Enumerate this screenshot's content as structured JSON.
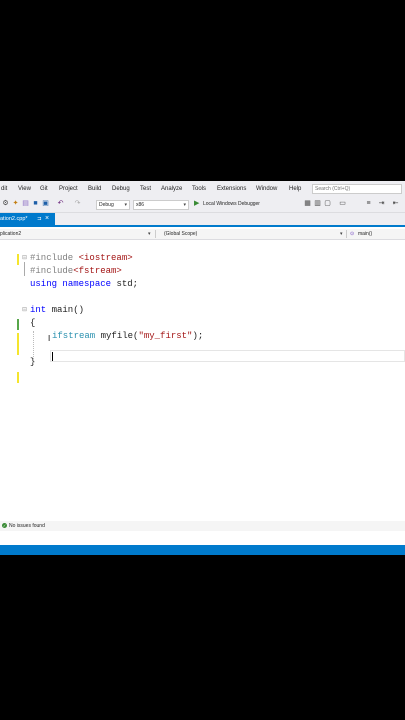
{
  "menu": {
    "items": [
      "dit",
      "View",
      "Git",
      "Project",
      "Build",
      "Debug",
      "Test",
      "Analyze",
      "Tools",
      "Extensions",
      "Window",
      "Help"
    ],
    "search_placeholder": "Search (Ctrl+Q)"
  },
  "toolbar": {
    "config": "Debug",
    "platform": "x86",
    "run_label": "Local Windows Debugger"
  },
  "tab": {
    "label": "ation2.cpp*",
    "pin": "⊐",
    "close": "×"
  },
  "navbar": {
    "project": "plication2",
    "scope": "(Global Scope)",
    "member": "main()"
  },
  "code": {
    "l1_dir": "#include",
    "l1_hdr": "<iostream>",
    "l2_dir": "#include",
    "l2_hdr": "<fstream>",
    "l3_kw1": "using",
    "l3_kw2": "namespace",
    "l3_rest": "std;",
    "l5_kw": "int",
    "l5_rest": "main()",
    "l6": "{",
    "l7_type": "ifstream",
    "l7_var": "myfile(",
    "l7_str": "\"my_first\"",
    "l7_end": ");",
    "l9": "}"
  },
  "status": {
    "issues": "No issues found"
  },
  "colors": {
    "accent": "#007acc",
    "keyword": "#0000ff",
    "type": "#2b91af",
    "string": "#a31515",
    "change_bar_yellow": "#f5e52d",
    "change_bar_green": "#57a64a"
  }
}
